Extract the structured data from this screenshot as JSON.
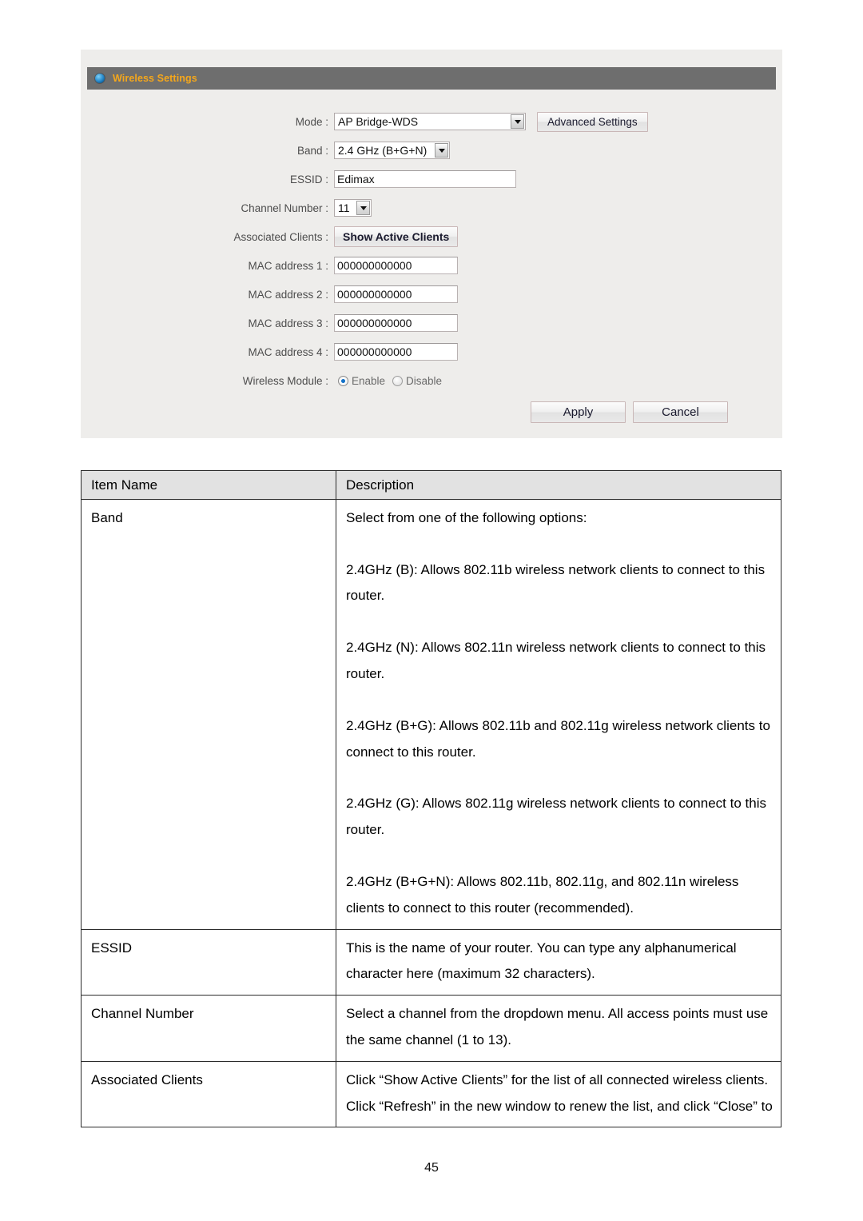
{
  "panel": {
    "header": {
      "icon": "radio-bullet-icon",
      "title": "Wireless Settings",
      "bar_color": "#6e6e6e",
      "title_color": "#f5a71b"
    },
    "fields": {
      "mode": {
        "label": "Mode :",
        "value": "AP Bridge-WDS",
        "advanced_button": "Advanced Settings"
      },
      "band": {
        "label": "Band :",
        "value": "2.4 GHz (B+G+N)"
      },
      "essid": {
        "label": "ESSID :",
        "value": "Edimax"
      },
      "channel": {
        "label": "Channel Number :",
        "value": "11"
      },
      "associated_clients": {
        "label": "Associated Clients :",
        "button": "Show Active Clients"
      },
      "mac1": {
        "label": "MAC address 1 :",
        "value": "000000000000"
      },
      "mac2": {
        "label": "MAC address 2 :",
        "value": "000000000000"
      },
      "mac3": {
        "label": "MAC address 3 :",
        "value": "000000000000"
      },
      "mac4": {
        "label": "MAC address 4 :",
        "value": "000000000000"
      },
      "wireless_module": {
        "label": "Wireless Module :",
        "enable_label": "Enable",
        "disable_label": "Disable",
        "selected": "Enable"
      }
    },
    "actions": {
      "apply": "Apply",
      "cancel": "Cancel"
    }
  },
  "table": {
    "headers": {
      "item": "Item Name",
      "description": "Description"
    },
    "rows": [
      {
        "item": "Band",
        "paragraphs": [
          "Select from one of the following options:",
          "2.4GHz (B): Allows 802.11b wireless network clients to connect to this router.",
          "2.4GHz (N): Allows 802.11n wireless network clients to connect to this router.",
          "2.4GHz (B+G): Allows 802.11b and 802.11g wireless network clients to connect to this router.",
          "2.4GHz (G): Allows 802.11g wireless network clients to connect to this router.",
          "2.4GHz (B+G+N): Allows 802.11b, 802.11g, and 802.11n wireless clients to connect to this router (recommended)."
        ]
      },
      {
        "item": "ESSID",
        "paragraphs": [
          "This is the name of your router. You can type any alphanumerical character here (maximum 32 characters)."
        ]
      },
      {
        "item": "Channel Number",
        "paragraphs": [
          "Select a channel from the dropdown menu. All access points must use the same channel (1 to 13)."
        ]
      },
      {
        "item": "Associated Clients",
        "paragraphs": [
          "Click “Show Active Clients” for the list of all connected wireless clients. Click “Refresh” in the new window to renew the list, and click “Close” to"
        ]
      }
    ]
  },
  "footer": {
    "page_number": "45"
  }
}
